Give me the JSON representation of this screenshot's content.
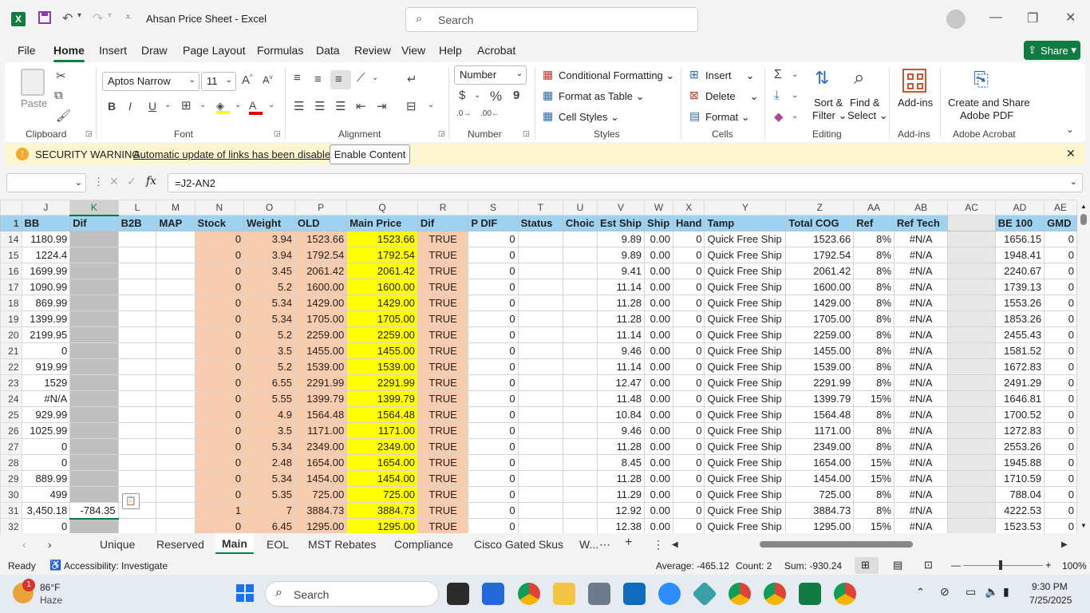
{
  "window": {
    "title": "Ahsan Price Sheet  -  Excel",
    "search_placeholder": "Search"
  },
  "menu": [
    "File",
    "Home",
    "Insert",
    "Draw",
    "Page Layout",
    "Formulas",
    "Data",
    "Review",
    "View",
    "Help",
    "Acrobat"
  ],
  "share_label": "Share",
  "ribbon": {
    "clipboard": {
      "paste": "Paste",
      "group": "Clipboard"
    },
    "font": {
      "family": "Aptos Narrow",
      "size": "11",
      "group": "Font",
      "bold": "B",
      "italic": "I",
      "underline": "U"
    },
    "alignment": {
      "group": "Alignment"
    },
    "number": {
      "format": "Number",
      "group": "Number",
      "currency": "$",
      "percent": "%",
      "comma": "9"
    },
    "styles": {
      "conditional": "Conditional Formatting",
      "format_table": "Format as Table",
      "cell_styles": "Cell Styles",
      "group": "Styles"
    },
    "cells": {
      "insert": "Insert",
      "delete": "Delete",
      "format": "Format",
      "group": "Cells"
    },
    "editing": {
      "sort1": "Sort &",
      "sort2": "Filter",
      "find1": "Find &",
      "find2": "Select",
      "group": "Editing"
    },
    "addins": {
      "label": "Add-ins",
      "group": "Add-ins"
    },
    "acrobat": {
      "line1": "Create and Share",
      "line2": "Adobe PDF",
      "group": "Adobe Acrobat"
    }
  },
  "warning": {
    "title": "SECURITY WARNING",
    "message": "Automatic update of links has been disabled",
    "button": "Enable Content"
  },
  "formula": {
    "namebox": "",
    "value": "=J2-AN2"
  },
  "grid": {
    "columns": [
      "J",
      "K",
      "L",
      "M",
      "N",
      "O",
      "P",
      "Q",
      "R",
      "S",
      "T",
      "U",
      "V",
      "W",
      "X",
      "Y",
      "Z",
      "AA",
      "AB",
      "AC",
      "AD",
      "AE"
    ],
    "headers": [
      "BB",
      "Dif",
      "B2B",
      "MAP",
      "Stock",
      "Weight",
      "OLD",
      "Main Price",
      "Dif",
      "P DIF",
      "Status",
      "Choic",
      "Est Ship",
      "Ship",
      "Hand",
      "Tamp",
      "Total COG",
      "Ref",
      "Ref Tech",
      "",
      "BE 100",
      "GMD"
    ],
    "rows": [
      {
        "n": "14",
        "J": "1180.99",
        "K": "",
        "N": "0",
        "O": "3.94",
        "P": "1523.66",
        "Q": "1523.66",
        "R": "TRUE",
        "S": "0",
        "V": "9.89",
        "W": "0.00",
        "X": "0",
        "Y": "Quick Free Ship",
        "Z": "1523.66",
        "AA": "8%",
        "AB": "#N/A",
        "AD": "1656.15",
        "AE": "0"
      },
      {
        "n": "15",
        "J": "1224.4",
        "K": "",
        "N": "0",
        "O": "3.94",
        "P": "1792.54",
        "Q": "1792.54",
        "R": "TRUE",
        "S": "0",
        "V": "9.89",
        "W": "0.00",
        "X": "0",
        "Y": "Quick Free Ship",
        "Z": "1792.54",
        "AA": "8%",
        "AB": "#N/A",
        "AD": "1948.41",
        "AE": "0"
      },
      {
        "n": "16",
        "J": "1699.99",
        "K": "",
        "N": "0",
        "O": "3.45",
        "P": "2061.42",
        "Q": "2061.42",
        "R": "TRUE",
        "S": "0",
        "V": "9.41",
        "W": "0.00",
        "X": "0",
        "Y": "Quick Free Ship",
        "Z": "2061.42",
        "AA": "8%",
        "AB": "#N/A",
        "AD": "2240.67",
        "AE": "0"
      },
      {
        "n": "17",
        "J": "1090.99",
        "K": "",
        "N": "0",
        "O": "5.2",
        "P": "1600.00",
        "Q": "1600.00",
        "R": "TRUE",
        "S": "0",
        "V": "11.14",
        "W": "0.00",
        "X": "0",
        "Y": "Quick Free Ship",
        "Z": "1600.00",
        "AA": "8%",
        "AB": "#N/A",
        "AD": "1739.13",
        "AE": "0"
      },
      {
        "n": "18",
        "J": "869.99",
        "K": "",
        "N": "0",
        "O": "5.34",
        "P": "1429.00",
        "Q": "1429.00",
        "R": "TRUE",
        "S": "0",
        "V": "11.28",
        "W": "0.00",
        "X": "0",
        "Y": "Quick Free Ship",
        "Z": "1429.00",
        "AA": "8%",
        "AB": "#N/A",
        "AD": "1553.26",
        "AE": "0"
      },
      {
        "n": "19",
        "J": "1399.99",
        "K": "",
        "N": "0",
        "O": "5.34",
        "P": "1705.00",
        "Q": "1705.00",
        "R": "TRUE",
        "S": "0",
        "V": "11.28",
        "W": "0.00",
        "X": "0",
        "Y": "Quick Free Ship",
        "Z": "1705.00",
        "AA": "8%",
        "AB": "#N/A",
        "AD": "1853.26",
        "AE": "0"
      },
      {
        "n": "20",
        "J": "2199.95",
        "K": "",
        "N": "0",
        "O": "5.2",
        "P": "2259.00",
        "Q": "2259.00",
        "R": "TRUE",
        "S": "0",
        "V": "11.14",
        "W": "0.00",
        "X": "0",
        "Y": "Quick Free Ship",
        "Z": "2259.00",
        "AA": "8%",
        "AB": "#N/A",
        "AD": "2455.43",
        "AE": "0"
      },
      {
        "n": "21",
        "J": "0",
        "K": "",
        "N": "0",
        "O": "3.5",
        "P": "1455.00",
        "Q": "1455.00",
        "R": "TRUE",
        "S": "0",
        "V": "9.46",
        "W": "0.00",
        "X": "0",
        "Y": "Quick Free Ship",
        "Z": "1455.00",
        "AA": "8%",
        "AB": "#N/A",
        "AD": "1581.52",
        "AE": "0"
      },
      {
        "n": "22",
        "J": "919.99",
        "K": "",
        "N": "0",
        "O": "5.2",
        "P": "1539.00",
        "Q": "1539.00",
        "R": "TRUE",
        "S": "0",
        "V": "11.14",
        "W": "0.00",
        "X": "0",
        "Y": "Quick Free Ship",
        "Z": "1539.00",
        "AA": "8%",
        "AB": "#N/A",
        "AD": "1672.83",
        "AE": "0"
      },
      {
        "n": "23",
        "J": "1529",
        "K": "",
        "N": "0",
        "O": "6.55",
        "P": "2291.99",
        "Q": "2291.99",
        "R": "TRUE",
        "S": "0",
        "V": "12.47",
        "W": "0.00",
        "X": "0",
        "Y": "Quick Free Ship",
        "Z": "2291.99",
        "AA": "8%",
        "AB": "#N/A",
        "AD": "2491.29",
        "AE": "0"
      },
      {
        "n": "24",
        "J": "#N/A",
        "K": "",
        "N": "0",
        "O": "5.55",
        "P": "1399.79",
        "Q": "1399.79",
        "R": "TRUE",
        "S": "0",
        "V": "11.48",
        "W": "0.00",
        "X": "0",
        "Y": "Quick Free Ship",
        "Z": "1399.79",
        "AA": "15%",
        "AB": "#N/A",
        "AD": "1646.81",
        "AE": "0"
      },
      {
        "n": "25",
        "J": "929.99",
        "K": "",
        "N": "0",
        "O": "4.9",
        "P": "1564.48",
        "Q": "1564.48",
        "R": "TRUE",
        "S": "0",
        "V": "10.84",
        "W": "0.00",
        "X": "0",
        "Y": "Quick Free Ship",
        "Z": "1564.48",
        "AA": "8%",
        "AB": "#N/A",
        "AD": "1700.52",
        "AE": "0"
      },
      {
        "n": "26",
        "J": "1025.99",
        "K": "",
        "N": "0",
        "O": "3.5",
        "P": "1171.00",
        "Q": "1171.00",
        "R": "TRUE",
        "S": "0",
        "V": "9.46",
        "W": "0.00",
        "X": "0",
        "Y": "Quick Free Ship",
        "Z": "1171.00",
        "AA": "8%",
        "AB": "#N/A",
        "AD": "1272.83",
        "AE": "0"
      },
      {
        "n": "27",
        "J": "0",
        "K": "",
        "N": "0",
        "O": "5.34",
        "P": "2349.00",
        "Q": "2349.00",
        "R": "TRUE",
        "S": "0",
        "V": "11.28",
        "W": "0.00",
        "X": "0",
        "Y": "Quick Free Ship",
        "Z": "2349.00",
        "AA": "8%",
        "AB": "#N/A",
        "AD": "2553.26",
        "AE": "0"
      },
      {
        "n": "28",
        "J": "0",
        "K": "",
        "N": "0",
        "O": "2.48",
        "P": "1654.00",
        "Q": "1654.00",
        "R": "TRUE",
        "S": "0",
        "V": "8.45",
        "W": "0.00",
        "X": "0",
        "Y": "Quick Free Ship",
        "Z": "1654.00",
        "AA": "15%",
        "AB": "#N/A",
        "AD": "1945.88",
        "AE": "0"
      },
      {
        "n": "29",
        "J": "889.99",
        "K": "",
        "N": "0",
        "O": "5.34",
        "P": "1454.00",
        "Q": "1454.00",
        "R": "TRUE",
        "S": "0",
        "V": "11.28",
        "W": "0.00",
        "X": "0",
        "Y": "Quick Free Ship",
        "Z": "1454.00",
        "AA": "15%",
        "AB": "#N/A",
        "AD": "1710.59",
        "AE": "0"
      },
      {
        "n": "30",
        "J": "499",
        "K": "",
        "N": "0",
        "O": "5.35",
        "P": "725.00",
        "Q": "725.00",
        "R": "TRUE",
        "S": "0",
        "V": "11.29",
        "W": "0.00",
        "X": "0",
        "Y": "Quick Free Ship",
        "Z": "725.00",
        "AA": "8%",
        "AB": "#N/A",
        "AD": "788.04",
        "AE": "0"
      },
      {
        "n": "31",
        "J": "3,450.18",
        "K": "-784.35",
        "N": "1",
        "O": "7",
        "P": "3884.73",
        "Q": "3884.73",
        "R": "TRUE",
        "S": "0",
        "V": "12.92",
        "W": "0.00",
        "X": "0",
        "Y": "Quick Free Ship",
        "Z": "3884.73",
        "AA": "8%",
        "AB": "#N/A",
        "AD": "4222.53",
        "AE": "0"
      },
      {
        "n": "32",
        "J": "0",
        "K": "",
        "N": "0",
        "O": "6.45",
        "P": "1295.00",
        "Q": "1295.00",
        "R": "TRUE",
        "S": "0",
        "V": "12.38",
        "W": "0.00",
        "X": "0",
        "Y": "Quick Free Ship",
        "Z": "1295.00",
        "AA": "15%",
        "AB": "#N/A",
        "AD": "1523.53",
        "AE": "0"
      }
    ]
  },
  "sheets": [
    "Unique",
    "Reserved",
    "Main",
    "EOL",
    "MST Rebates",
    "Compliance",
    "Cisco Gated Skus",
    "W..."
  ],
  "active_sheet": "Main",
  "status": {
    "ready": "Ready",
    "accessibility": "Accessibility: Investigate",
    "average": "Average: -465.12",
    "count": "Count: 2",
    "sum": "Sum: -930.24",
    "zoom": "100%"
  },
  "taskbar": {
    "temp": "86°F",
    "weather": "Haze",
    "badge": "1",
    "search": "Search",
    "time": "9:30 PM",
    "date": "7/25/2025"
  }
}
